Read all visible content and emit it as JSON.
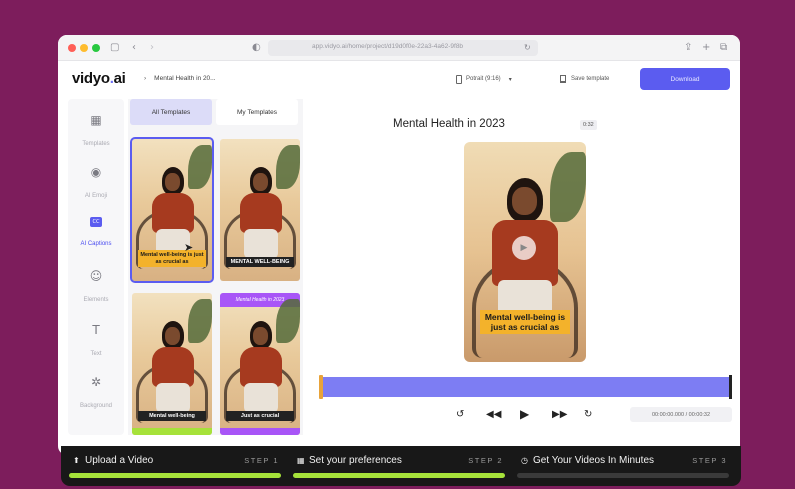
{
  "browser": {
    "url": "app.vidyo.ai/home/project/d19d0f0e-22a3-4a62-9f8b"
  },
  "app": {
    "logo_text": "vidyo",
    "logo_dot": ".",
    "logo_suffix": "ai",
    "breadcrumb": "Mental Health in 20...",
    "format_label": "Potrait (9:16)",
    "save_template_label": "Save template",
    "download_label": "Download"
  },
  "tools": [
    {
      "label": "Templates",
      "icon": "template-icon"
    },
    {
      "label": "AI Emoji",
      "icon": "emoji-icon"
    },
    {
      "label": "AI Captions",
      "icon": "captions-icon"
    },
    {
      "label": "Elements",
      "icon": "elements-icon"
    },
    {
      "label": "Text",
      "icon": "text-icon"
    },
    {
      "label": "Background",
      "icon": "background-icon"
    }
  ],
  "template_tabs": [
    "All Templates",
    "My Templates"
  ],
  "templates": [
    {
      "caption": "Mental well-being is just as crucial as"
    },
    {
      "caption": "MENTAL WELL-BEING"
    },
    {
      "caption": "Mental well-being"
    },
    {
      "banner": "Mental Health in 2023",
      "caption": "Just as crucial"
    }
  ],
  "preview": {
    "title": "Mental Health in 2023",
    "duration": "0:32",
    "caption": "Mental well-being is just as crucial as",
    "timecode": "00:00:00.000 / 00:00:32"
  },
  "steps": [
    {
      "label": "Upload a Video",
      "step": "STEP 1",
      "progress": 1.0
    },
    {
      "label": "Set your preferences",
      "step": "STEP 2",
      "progress": 1.0
    },
    {
      "label": "Get Your Videos In Minutes",
      "step": "STEP 3",
      "progress": 0.0
    }
  ],
  "colors": {
    "background": "#7d1d5c",
    "accent": "#5b5cf0",
    "progress": "#a6e23a",
    "caption": "#f3b22b"
  }
}
